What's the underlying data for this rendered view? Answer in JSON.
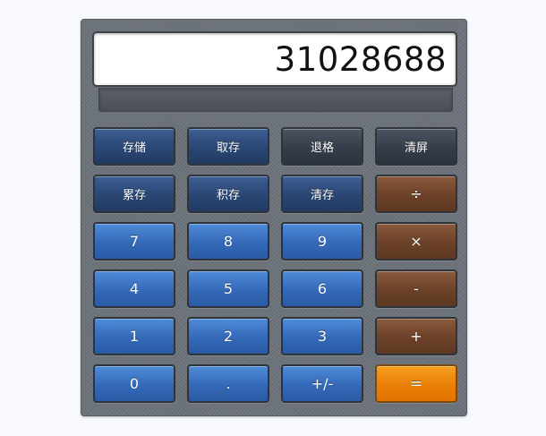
{
  "display": {
    "value": "31028688"
  },
  "keys": {
    "store": "存储",
    "recall": "取存",
    "backspace": "退格",
    "clear": "清屏",
    "mem_add": "累存",
    "mem_mul": "积存",
    "mem_clear": "清存",
    "divide": "÷",
    "seven": "7",
    "eight": "8",
    "nine": "9",
    "multiply": "×",
    "four": "4",
    "five": "5",
    "six": "6",
    "minus": "-",
    "one": "1",
    "two": "2",
    "three": "3",
    "plus": "+",
    "zero": "0",
    "dot": ".",
    "negate": "+/-",
    "equals": "="
  },
  "colors": {
    "function_key": "#2a4673",
    "clear_key": "#353d49",
    "number_key": "#3469b8",
    "operator_key": "#6c4129",
    "equals_key": "#ea7f06",
    "body": "#6d737b"
  }
}
